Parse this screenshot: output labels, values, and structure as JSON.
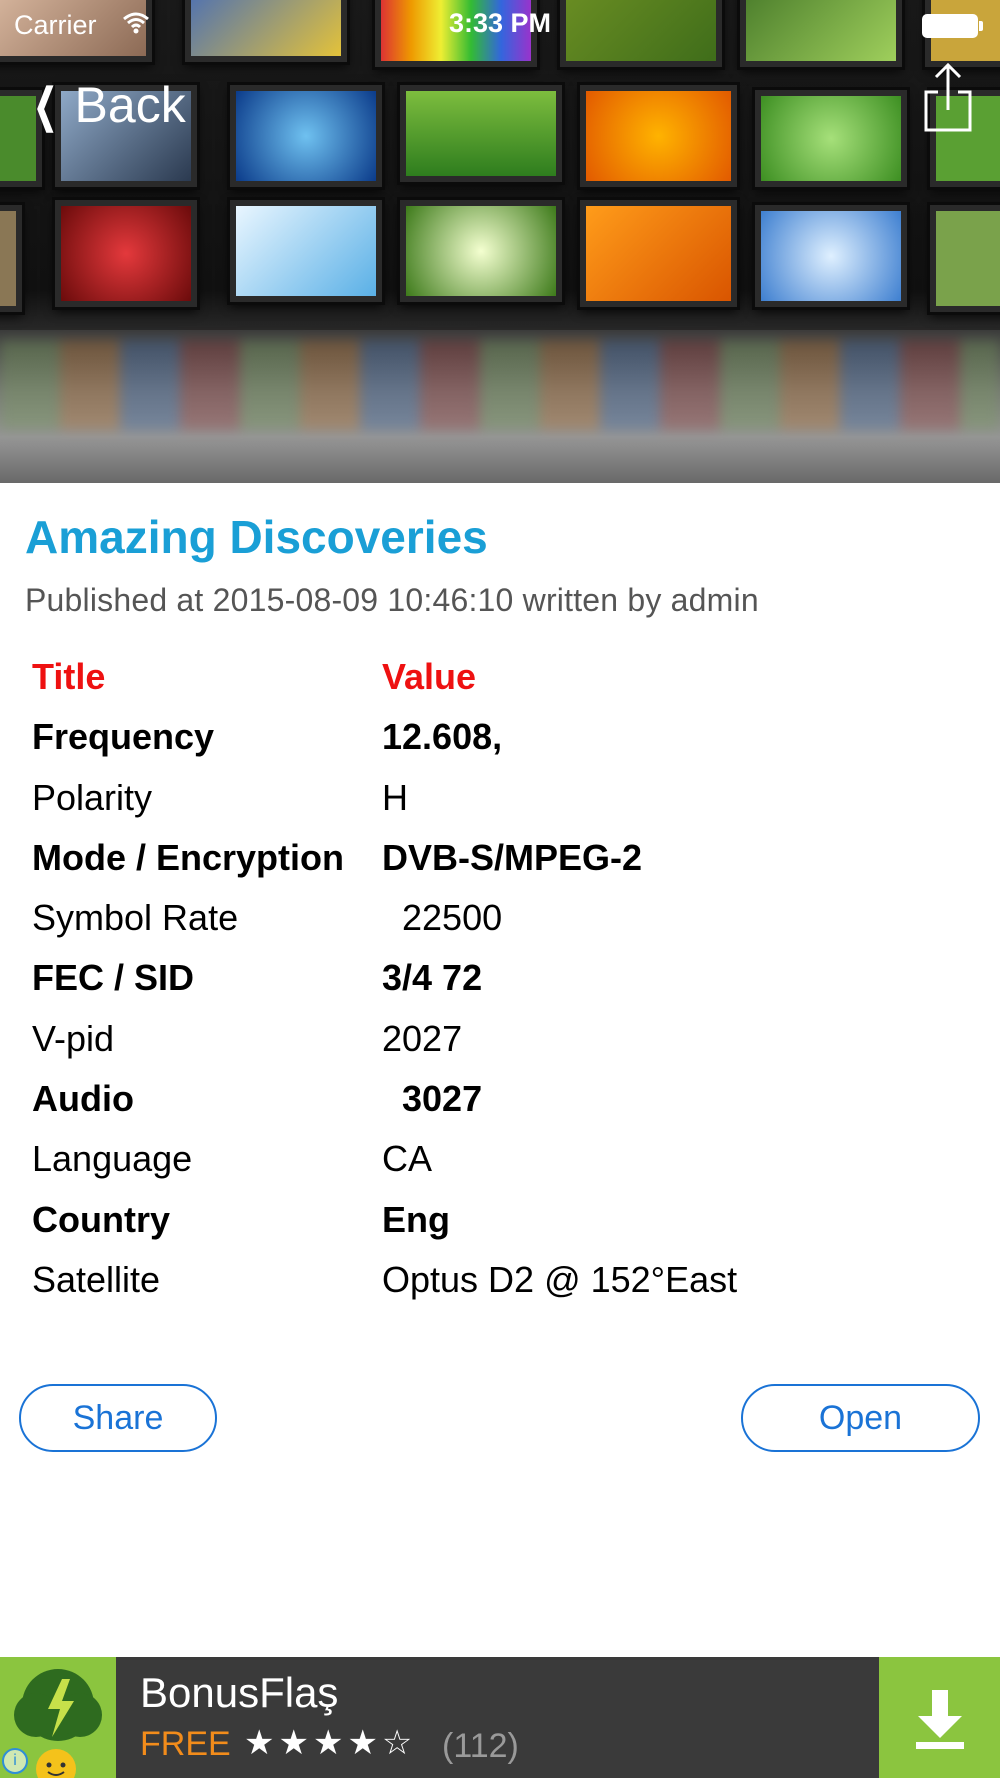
{
  "status_bar": {
    "carrier": "Carrier",
    "time": "3:33 PM"
  },
  "nav": {
    "back_label": "Back"
  },
  "article": {
    "title": "Amazing Discoveries",
    "meta": "Published at 2015-08-09 10:46:10 written by admin"
  },
  "table": {
    "header": {
      "key": "Title",
      "value": "Value"
    },
    "rows": [
      {
        "key": "Frequency",
        "value": "12.608,"
      },
      {
        "key": "Polarity",
        "value": "H"
      },
      {
        "key": "Mode / Encryption",
        "value": "DVB-S/MPEG-2"
      },
      {
        "key": "Symbol Rate",
        "value": "  22500"
      },
      {
        "key": "FEC / SID",
        "value": "3/4 72"
      },
      {
        "key": "V-pid",
        "value": "2027"
      },
      {
        "key": "Audio",
        "value": "  3027"
      },
      {
        "key": "Language",
        "value": "CA"
      },
      {
        "key": "Country",
        "value": "Eng"
      },
      {
        "key": "Satellite",
        "value": "Optus D2 @ 152°East"
      }
    ]
  },
  "actions": {
    "share_label": "Share",
    "open_label": "Open"
  },
  "ad": {
    "app_name": "BonusFlaş",
    "price": "FREE",
    "stars": "★★★★☆",
    "rating": 4,
    "review_count": "(112)"
  },
  "colors": {
    "title": "#1a9fd6",
    "header": "#ee1111",
    "button": "#1a73d6",
    "ad_green": "#8bc53f",
    "ad_orange": "#f28c1b"
  }
}
